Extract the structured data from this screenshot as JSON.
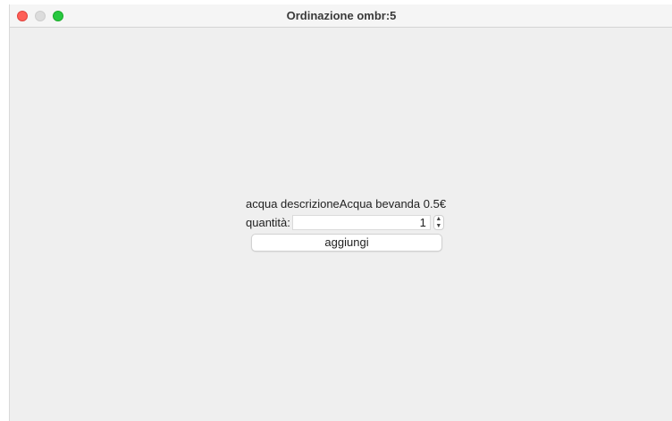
{
  "window": {
    "title": "Ordinazione ombr:5"
  },
  "item": {
    "description": "acqua descrizioneAcqua bevanda 0.5€"
  },
  "quantity": {
    "label": "quantità:",
    "value": "1"
  },
  "actions": {
    "add_label": "aggiungi"
  },
  "icons": {
    "close": "close-dot-icon",
    "minimize": "minimize-dot-icon",
    "maximize": "maximize-dot-icon",
    "stepper_up": "chevron-up-icon",
    "stepper_down": "chevron-down-icon"
  },
  "colors": {
    "close": "#fe5f57",
    "minimize": "#dcdcdc",
    "maximize": "#28c840",
    "window_bg": "#efefef"
  }
}
